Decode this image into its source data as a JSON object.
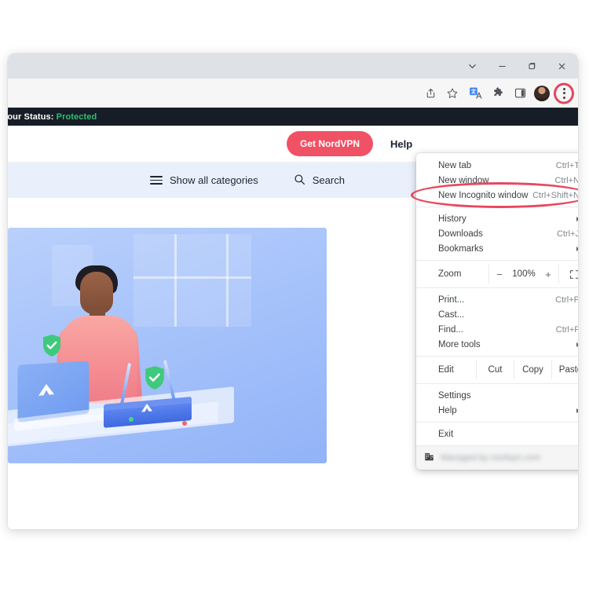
{
  "window_controls": [
    {
      "name": "tab-search",
      "icon": "chevron-down-icon"
    },
    {
      "name": "minimize",
      "icon": "minimize-icon"
    },
    {
      "name": "maximize",
      "icon": "maximize-icon"
    },
    {
      "name": "close",
      "icon": "close-icon"
    }
  ],
  "toolbar": {
    "icons": [
      {
        "name": "share-icon"
      },
      {
        "name": "bookmark-star-icon"
      },
      {
        "name": "translate-icon"
      },
      {
        "name": "extensions-puzzle-icon"
      },
      {
        "name": "side-panel-icon"
      },
      {
        "name": "profile-avatar"
      },
      {
        "name": "three-dot-menu-icon"
      }
    ],
    "highlight_color": "#e0465f"
  },
  "page": {
    "status_bar": {
      "prefix": "· Your Status:",
      "value": "Protected",
      "value_color": "#2fbf71",
      "background": "#161d26"
    },
    "header": {
      "cta_label": "Get NordVPN",
      "cta_color": "#f05164",
      "help_label": "Help"
    },
    "nav": {
      "categories_label": "Show all categories",
      "search_label": "Search",
      "background": "#eaf0fb"
    },
    "illustration": {
      "alt": "person-at-laptop-with-router-illustration"
    }
  },
  "chrome_menu": {
    "groups": [
      {
        "items": [
          {
            "label": "New tab",
            "accel": "Ctrl+T",
            "arrow": false,
            "highlighted": false
          },
          {
            "label": "New window",
            "accel": "Ctrl+N",
            "arrow": false,
            "highlighted": false
          },
          {
            "label": "New Incognito window",
            "accel": "Ctrl+Shift+N",
            "arrow": false,
            "highlighted": true
          }
        ]
      },
      {
        "items": [
          {
            "label": "History",
            "accel": "",
            "arrow": true,
            "highlighted": false
          },
          {
            "label": "Downloads",
            "accel": "Ctrl+J",
            "arrow": false,
            "highlighted": false
          },
          {
            "label": "Bookmarks",
            "accel": "",
            "arrow": true,
            "highlighted": false
          }
        ]
      }
    ],
    "zoom": {
      "label": "Zoom",
      "minus": "−",
      "value": "100%",
      "plus": "+",
      "fullscreen_icon": "fullscreen-icon"
    },
    "group3": [
      {
        "label": "Print...",
        "accel": "Ctrl+P",
        "arrow": false
      },
      {
        "label": "Cast...",
        "accel": "",
        "arrow": false
      },
      {
        "label": "Find...",
        "accel": "Ctrl+F",
        "arrow": false
      },
      {
        "label": "More tools",
        "accel": "",
        "arrow": true
      }
    ],
    "edit_row": {
      "label": "Edit",
      "buttons": [
        "Cut",
        "Copy",
        "Paste"
      ]
    },
    "group4": [
      {
        "label": "Settings",
        "accel": "",
        "arrow": false
      },
      {
        "label": "Help",
        "accel": "",
        "arrow": true
      }
    ],
    "group5": [
      {
        "label": "Exit",
        "accel": "",
        "arrow": false
      }
    ],
    "managed": {
      "icon": "enterprise-building-icon",
      "text": "Managed by nordvpn.com"
    },
    "highlight_color": "#e8475f"
  }
}
